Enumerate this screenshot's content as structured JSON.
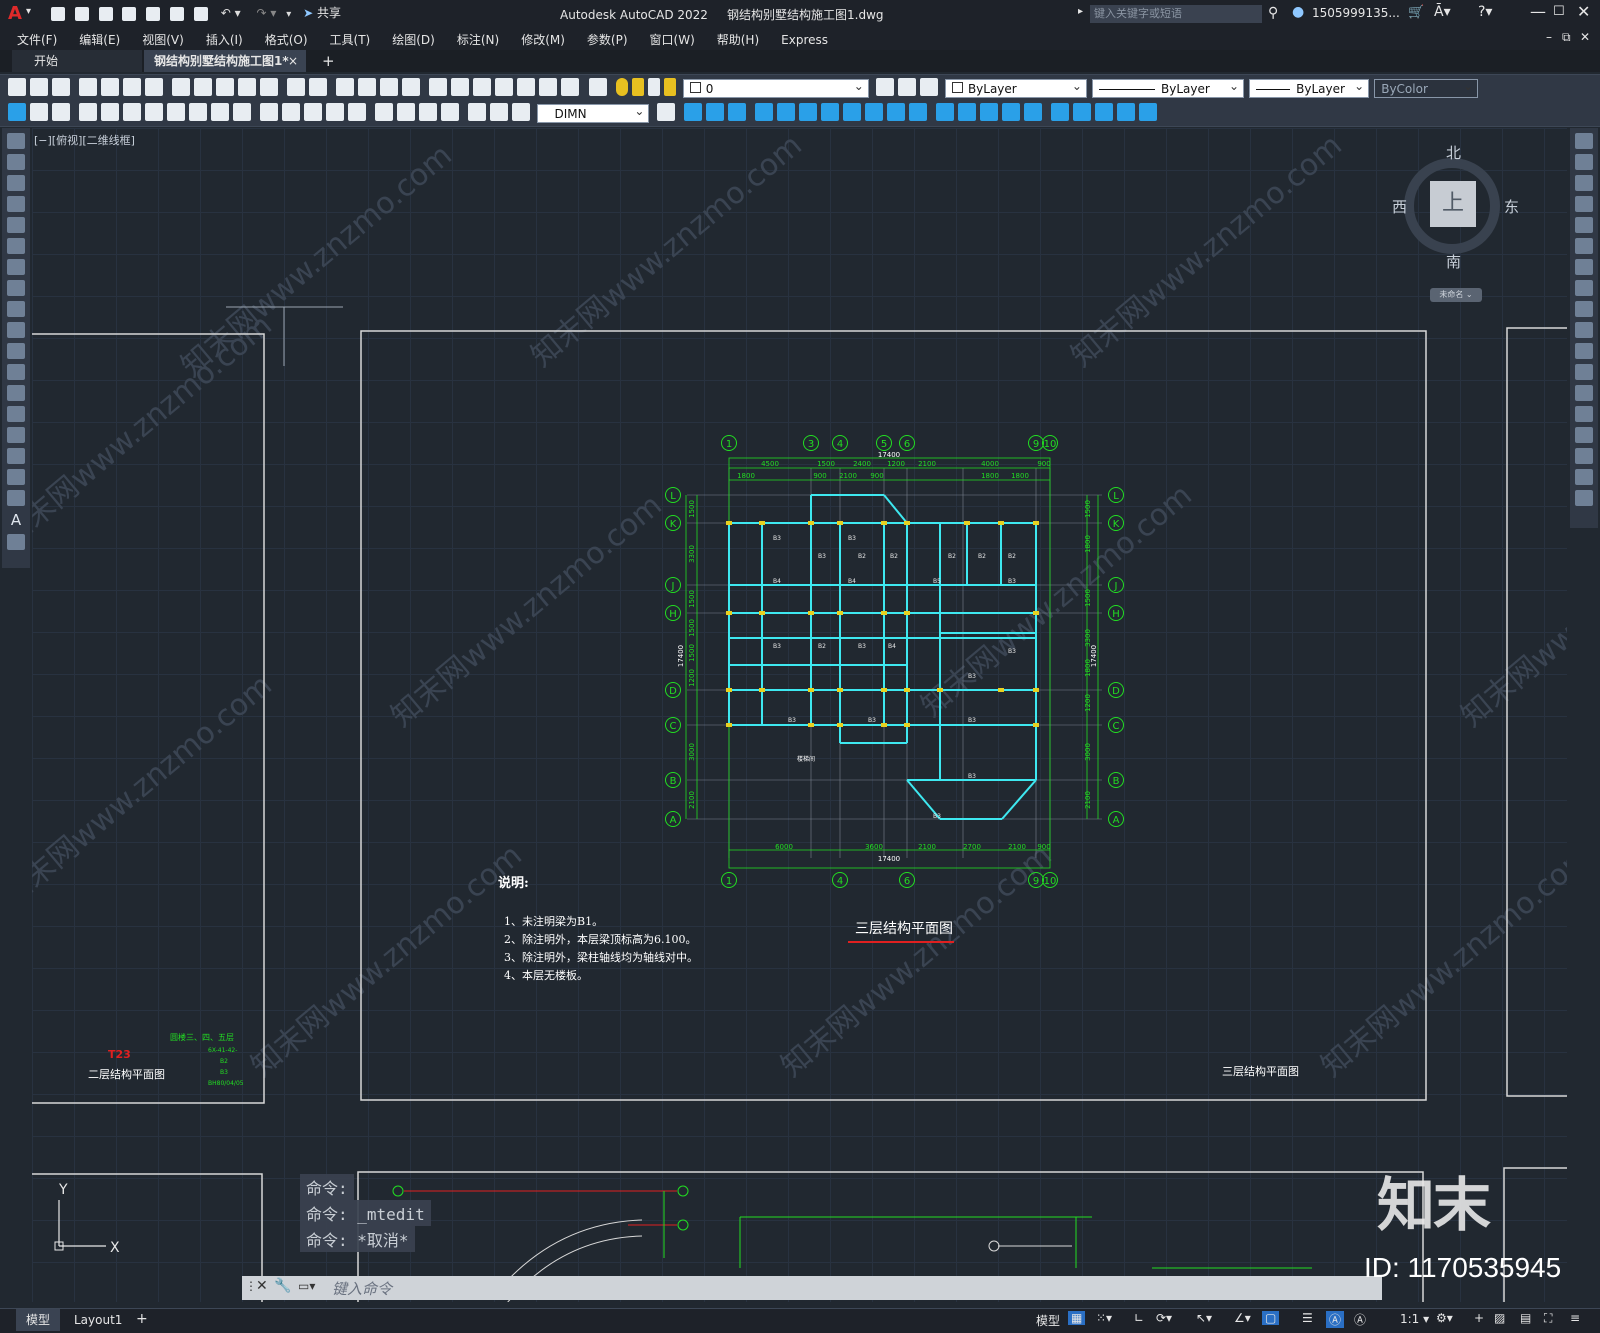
{
  "app": {
    "title": "Autodesk AutoCAD 2022",
    "filename": "钢结构别墅结构施工图1.dwg",
    "share_label": "共享",
    "search_placeholder": "键入关键字或短语",
    "user": "1505999135...",
    "logo_letter": "A"
  },
  "menu": [
    "文件(F)",
    "编辑(E)",
    "视图(V)",
    "插入(I)",
    "格式(O)",
    "工具(T)",
    "绘图(D)",
    "标注(N)",
    "修改(M)",
    "参数(P)",
    "窗口(W)",
    "帮助(H)",
    "Express"
  ],
  "tabs": {
    "start": "开始",
    "doc": "钢结构别墅结构施工图1*",
    "close": "×",
    "add": "+"
  },
  "toolbar": {
    "layer_value": "0",
    "color_value": "ByLayer",
    "linetype_value": "ByLayer",
    "lineweight_value": "ByLayer",
    "plotstyle_value": "ByColor",
    "dimstyle_value": "DIMN"
  },
  "viewport": {
    "label": "[−][俯视][二维线框]"
  },
  "viewcube": {
    "north": "北",
    "south": "南",
    "east": "东",
    "west": "西",
    "top": "上",
    "ucs_menu": "未命名 ⌄"
  },
  "drawing": {
    "title": "三层结构平面图",
    "corner_title": "三层结构平面图",
    "notes_heading": "说明:",
    "notes": [
      "1、未注明梁为B1。",
      "2、除注明外，本层梁顶标高为6.100。",
      "3、除注明外，梁柱轴线均为轴线对中。",
      "4、本层无楼板。"
    ],
    "total_dim": "17400",
    "top_dims": [
      "4500",
      "1500",
      "2400",
      "1200",
      "2100",
      "4000",
      "900"
    ],
    "top_subdims": [
      "1800",
      "900",
      "2100",
      "900",
      "1800",
      "1800"
    ],
    "bottom_dims": [
      "6000",
      "3600",
      "2100",
      "2700",
      "2100",
      "900"
    ],
    "left_dims": [
      "1500",
      "3300",
      "1500",
      "1500",
      "1500",
      "1200",
      "3000",
      "2100"
    ],
    "right_dims": [
      "1500",
      "1800",
      "1500",
      "3300",
      "1800",
      "1200",
      "3000",
      "2100"
    ],
    "vertical_total": "17400",
    "top_axes": [
      "1",
      "3",
      "4",
      "5",
      "6",
      "9",
      "10"
    ],
    "bottom_axes": [
      "1",
      "4",
      "6",
      "9",
      "10"
    ],
    "row_axes": [
      "L",
      "K",
      "J",
      "H",
      "D",
      "C",
      "B",
      "A"
    ],
    "left_sheet_title": "二层结构平面图",
    "left_sheet_code": "T23",
    "left_sheet_green_lines": [
      "圆楼三、四、五层",
      "6X-41-42-",
      "B2",
      "B3",
      "BH80/04/05"
    ],
    "small_label": "楼梯间"
  },
  "command": {
    "history": [
      "命令:",
      "命令:  _mtedit",
      "命令: *取消*"
    ],
    "input_placeholder": "键入命令"
  },
  "axes_labels": {
    "y": "Y",
    "x": "X"
  },
  "status": {
    "model_tab": "模型",
    "layout_tab": "Layout1",
    "model_btn": "模型",
    "scale": "1:1"
  },
  "watermark": {
    "text": "知末网www.znzmo.com",
    "brand": "知末",
    "id": "ID: 1170535945"
  },
  "colors": {
    "background": "#212830",
    "structure": "#3ee8f0",
    "dimension": "#22dd22",
    "sheet_border": "#d8d8d8",
    "accent_red": "#e02020"
  }
}
